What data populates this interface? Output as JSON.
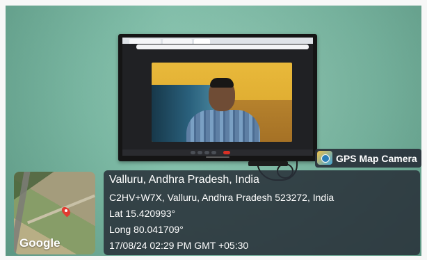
{
  "overlay": {
    "badge_label": "GPS Map Camera",
    "map_brand": "Google",
    "address_line1": "Valluru, Andhra Pradesh, India",
    "address_line2": "C2HV+W7X, Valluru, Andhra Pradesh 523272, India",
    "latitude": "Lat 15.420993°",
    "longitude": "Long 80.041709°",
    "timestamp": "17/08/24 02:29 PM GMT +05:30"
  },
  "colors": {
    "wall": "#79b9a3",
    "overlay_background": "#282f38",
    "overlay_text": "#ffffff",
    "map_pin": "#e23b31"
  },
  "icons": {
    "camera_badge": "gps-map-camera-icon",
    "location_marker": "map-pin-icon"
  }
}
